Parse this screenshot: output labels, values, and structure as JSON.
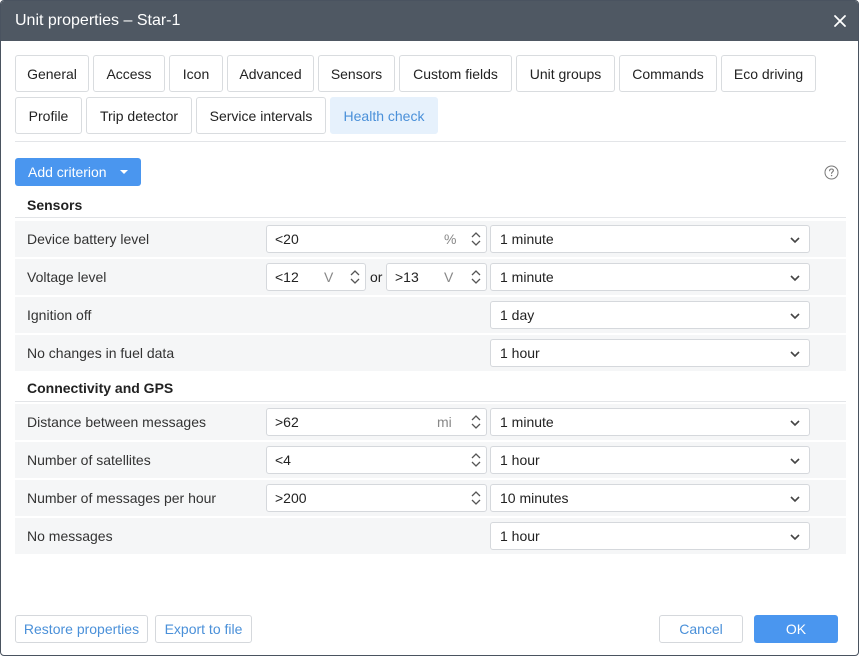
{
  "window": {
    "title": "Unit properties – Star-1",
    "close_icon": "close-icon"
  },
  "tabs": [
    {
      "label": "General"
    },
    {
      "label": "Access"
    },
    {
      "label": "Icon"
    },
    {
      "label": "Advanced"
    },
    {
      "label": "Sensors"
    },
    {
      "label": "Custom fields"
    },
    {
      "label": "Unit groups"
    },
    {
      "label": "Commands"
    },
    {
      "label": "Eco driving"
    },
    {
      "label": "Profile"
    },
    {
      "label": "Trip detector"
    },
    {
      "label": "Service intervals"
    },
    {
      "label": "Health check",
      "active": true
    }
  ],
  "toolbar": {
    "add_criterion_label": "Add criterion",
    "help_icon": "help-icon"
  },
  "sections": {
    "sensors": {
      "title": "Sensors",
      "rows": [
        {
          "label": "Device battery level",
          "value": "<20",
          "unit": "%",
          "interval": "1 minute"
        },
        {
          "label": "Voltage level",
          "value_low": "<12",
          "unit_low": "V",
          "joiner": "or",
          "value_high": ">13",
          "unit_high": "V",
          "interval": "1 minute"
        },
        {
          "label": "Ignition off",
          "interval": "1 day"
        },
        {
          "label": "No changes in fuel data",
          "interval": "1 hour"
        }
      ]
    },
    "connectivity": {
      "title": "Connectivity and GPS",
      "rows": [
        {
          "label": "Distance between messages",
          "value": ">62",
          "unit": "mi",
          "interval": "1 minute"
        },
        {
          "label": "Number of satellites",
          "value": "<4",
          "interval": "1 hour"
        },
        {
          "label": "Number of messages per hour",
          "value": ">200",
          "interval": "10 minutes"
        },
        {
          "label": "No messages",
          "interval": "1 hour"
        }
      ]
    }
  },
  "footer": {
    "restore_label": "Restore properties",
    "export_label": "Export to file",
    "cancel_label": "Cancel",
    "ok_label": "OK"
  },
  "colors": {
    "accent": "#4a96ef",
    "titlebar": "#4f5863",
    "active_tab_bg": "#e6f1fc",
    "active_tab_text": "#4a90d9",
    "row_bg": "#f5f6f7"
  }
}
